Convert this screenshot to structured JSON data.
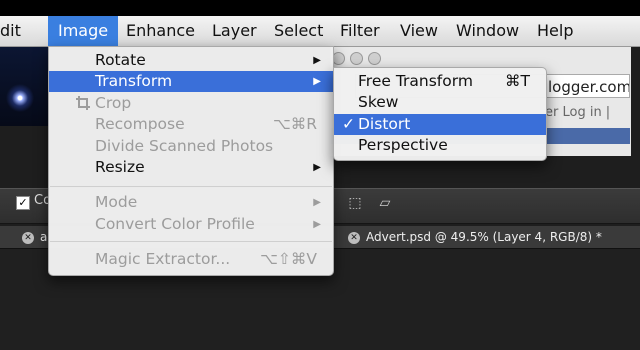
{
  "menubar": {
    "items": [
      "dit",
      "Image",
      "Enhance",
      "Layer",
      "Select",
      "Filter",
      "View",
      "Window",
      "Help"
    ],
    "active_index": 1
  },
  "browser": {
    "url_text": "logger.com/",
    "tabs_text": "er   Log in   |"
  },
  "options_bar": {
    "checkbox_label": "Co"
  },
  "doc_tabs": [
    {
      "label": "a"
    },
    {
      "label": "Advert.psd @ 49.5% (Layer 4, RGB/8) *"
    }
  ],
  "image_menu": {
    "items": [
      {
        "label": "Rotate",
        "shortcut": "",
        "submenu": true,
        "disabled": false,
        "highlight": false
      },
      {
        "label": "Transform",
        "shortcut": "",
        "submenu": true,
        "disabled": false,
        "highlight": true
      },
      {
        "label": "Crop",
        "shortcut": "",
        "submenu": false,
        "disabled": true,
        "highlight": false,
        "icon": "crop-icon"
      },
      {
        "label": "Recompose",
        "shortcut": "⌥⌘R",
        "submenu": false,
        "disabled": true,
        "highlight": false
      },
      {
        "label": "Divide Scanned Photos",
        "shortcut": "",
        "submenu": false,
        "disabled": true,
        "highlight": false
      },
      {
        "label": "Resize",
        "shortcut": "",
        "submenu": true,
        "disabled": false,
        "highlight": false
      },
      {
        "label": "Mode",
        "shortcut": "",
        "submenu": true,
        "disabled": true,
        "highlight": false
      },
      {
        "label": "Convert Color Profile",
        "shortcut": "",
        "submenu": true,
        "disabled": true,
        "highlight": false
      },
      {
        "label": "Magic Extractor...",
        "shortcut": "⌥⇧⌘V",
        "submenu": false,
        "disabled": true,
        "highlight": false
      }
    ]
  },
  "transform_submenu": {
    "items": [
      {
        "label": "Free Transform",
        "shortcut": "⌘T",
        "checked": false,
        "highlight": false
      },
      {
        "label": "Skew",
        "shortcut": "",
        "checked": false,
        "highlight": false
      },
      {
        "label": "Distort",
        "shortcut": "",
        "checked": true,
        "highlight": true
      },
      {
        "label": "Perspective",
        "shortcut": "",
        "checked": false,
        "highlight": false
      }
    ],
    "check_glyph": "✓"
  },
  "glyphs": {
    "submenu_arrow": "▶",
    "tab_close": "✕"
  },
  "colors": {
    "highlight": "#3a6fd9",
    "menubar_active": "#3a7fe0"
  }
}
